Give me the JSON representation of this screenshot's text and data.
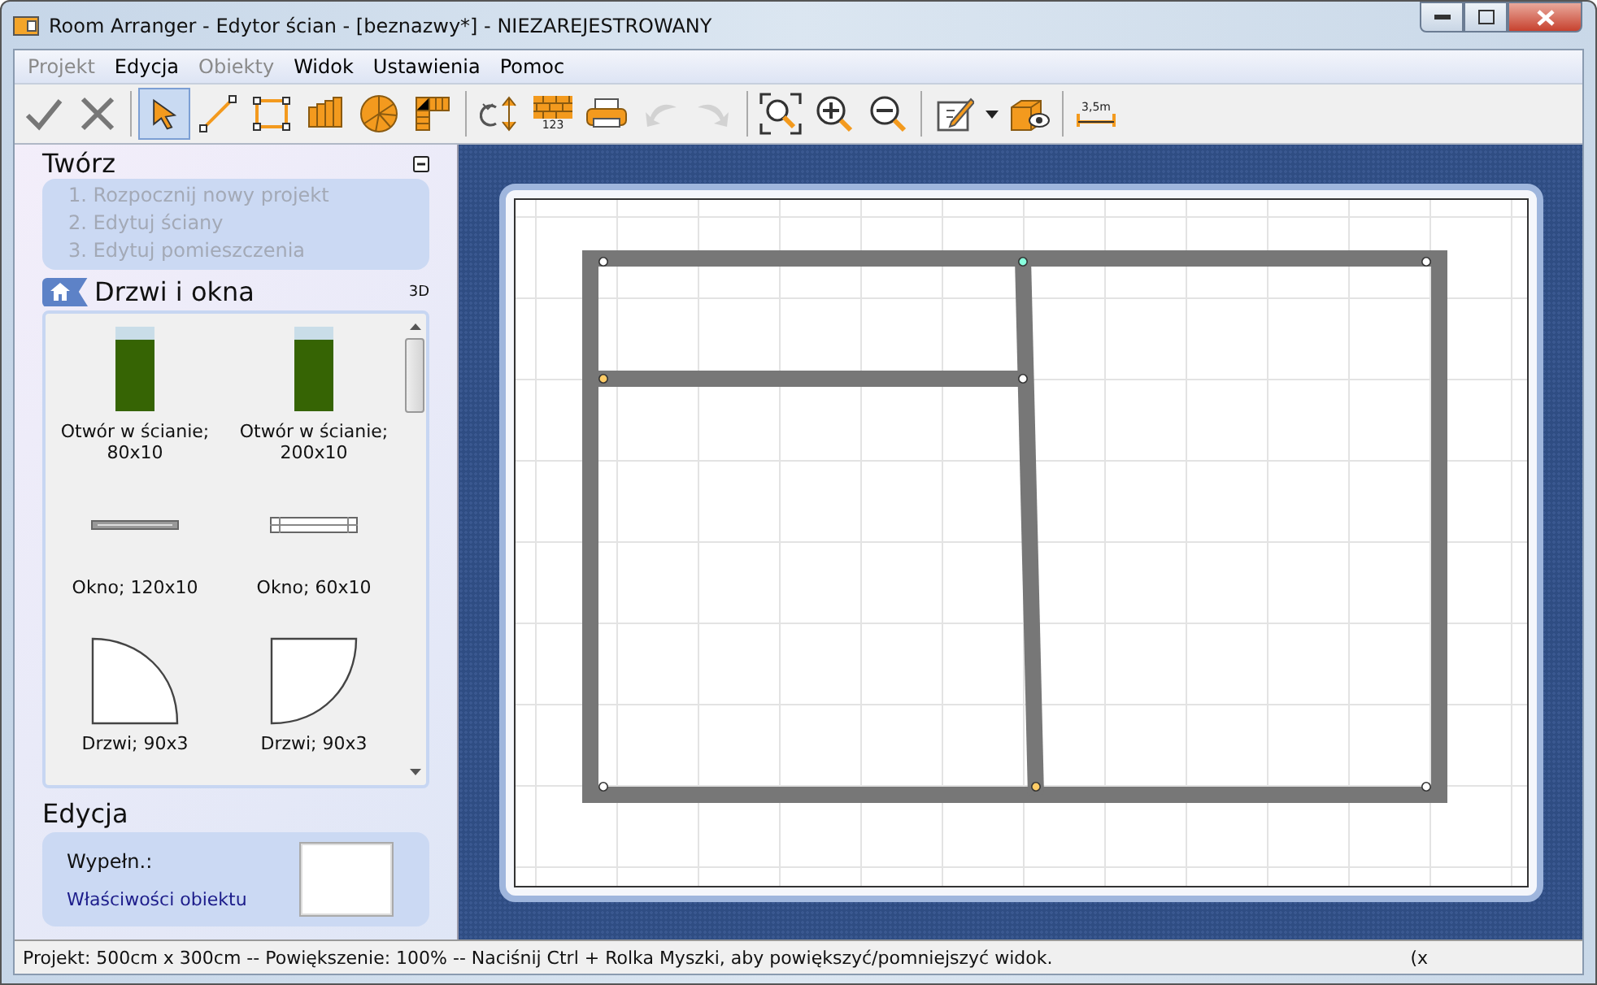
{
  "window": {
    "title": "Room Arranger - Edytor ścian - [beznazwy*] - NIEZAREJESTROWANY"
  },
  "menu": [
    {
      "label": "Projekt",
      "disabled": true
    },
    {
      "label": "Edycja",
      "disabled": false
    },
    {
      "label": "Obiekty",
      "disabled": true
    },
    {
      "label": "Widok",
      "disabled": false
    },
    {
      "label": "Ustawienia",
      "disabled": false
    },
    {
      "label": "Pomoc",
      "disabled": false
    }
  ],
  "toolbar": [
    {
      "kind": "check",
      "selected": false,
      "disabled": false
    },
    {
      "kind": "cross",
      "selected": false,
      "disabled": false
    },
    {
      "kind": "separator"
    },
    {
      "kind": "pointer",
      "selected": true,
      "disabled": false
    },
    {
      "kind": "line",
      "selected": false,
      "disabled": false
    },
    {
      "kind": "rect",
      "selected": false,
      "disabled": false
    },
    {
      "kind": "stairs",
      "selected": false,
      "disabled": false
    },
    {
      "kind": "spiral",
      "selected": false,
      "disabled": false
    },
    {
      "kind": "corner-stairs",
      "selected": false,
      "disabled": false
    },
    {
      "kind": "separator"
    },
    {
      "kind": "rotate",
      "selected": false,
      "disabled": false
    },
    {
      "kind": "bricks",
      "label": "123",
      "selected": false,
      "disabled": false
    },
    {
      "kind": "print",
      "selected": false,
      "disabled": false
    },
    {
      "kind": "undo",
      "selected": false,
      "disabled": true
    },
    {
      "kind": "redo",
      "selected": false,
      "disabled": true
    },
    {
      "kind": "separator"
    },
    {
      "kind": "zoom-fit",
      "selected": false,
      "disabled": false
    },
    {
      "kind": "zoom-in",
      "selected": false,
      "disabled": false
    },
    {
      "kind": "zoom-out",
      "selected": false,
      "disabled": false
    },
    {
      "kind": "separator"
    },
    {
      "kind": "edit",
      "selected": false,
      "disabled": false
    },
    {
      "kind": "caret",
      "selected": false,
      "disabled": false
    },
    {
      "kind": "view3d",
      "selected": false,
      "disabled": false
    },
    {
      "kind": "separator"
    },
    {
      "kind": "measure",
      "label": "3,5m",
      "selected": false,
      "disabled": false
    }
  ],
  "create": {
    "title": "Twórz",
    "steps": [
      {
        "label": "1. Rozpocznij nowy projekt",
        "disabled": true
      },
      {
        "label": "2. Edytuj ściany",
        "disabled": true
      },
      {
        "label": "3. Edytuj pomieszczenia",
        "disabled": true
      }
    ]
  },
  "library": {
    "title": "Drzwi i okna",
    "badge": "3D",
    "items": [
      {
        "kind": "opening",
        "label": "Otwór w ścianie; 80x10"
      },
      {
        "kind": "opening",
        "label": "Otwór w ścianie; 200x10"
      },
      {
        "kind": "window-thin",
        "label": "Okno; 120x10"
      },
      {
        "kind": "window-double",
        "label": "Okno; 60x10"
      },
      {
        "kind": "door-left",
        "label": "Drzwi; 90x3"
      },
      {
        "kind": "door-right",
        "label": "Drzwi; 90x3"
      }
    ]
  },
  "edit": {
    "title": "Edycja",
    "fill_label": "Wypełn.:",
    "link": "Właściwości obiektu"
  },
  "status_bar": {
    "text": "Projekt: 500cm x 300cm -- Powiększenie: 100% -- Naciśnij Ctrl + Rolka Myszki, aby powiększyć/pomniejszyć widok.",
    "coords": "(x"
  }
}
